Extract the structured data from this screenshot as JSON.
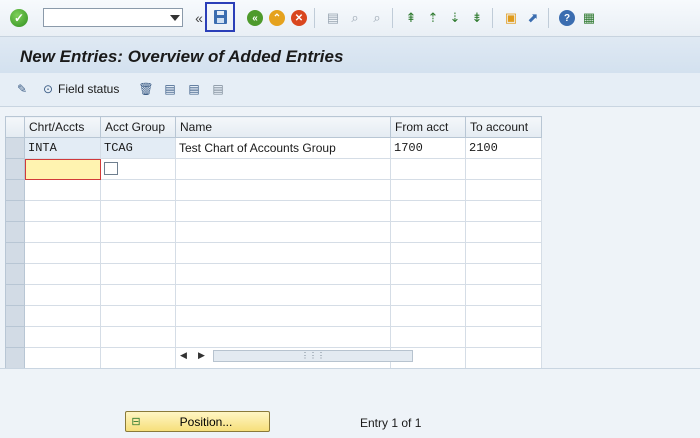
{
  "toolbar": {
    "command_value": "",
    "icons": [
      "enter-icon",
      "save-icon",
      "back-icon",
      "exit-icon",
      "cancel-icon",
      "print-icon",
      "find-icon",
      "find-next-icon",
      "first-page-icon",
      "previous-page-icon",
      "next-page-icon",
      "last-page-icon",
      "create-session-icon",
      "shortcut-icon",
      "help-icon",
      "customize-icon"
    ],
    "double_chevron": "«"
  },
  "title": "New Entries: Overview of Added Entries",
  "app_toolbar": {
    "field_status_label": "Field status"
  },
  "table": {
    "columns": [
      "Chrt/Accts",
      "Acct Group",
      "Name",
      "From acct",
      "To account"
    ],
    "rows": [
      {
        "chrt_accts": "INTA",
        "acct_group": "TCAG",
        "name": "Test Chart of Accounts Group",
        "from_acct": "1700",
        "to_account": "2100"
      }
    ]
  },
  "footer": {
    "position_label": "Position...",
    "entry_info": "Entry 1 of 1"
  },
  "colors": {
    "accent_save_border": "#2b3fb8",
    "input_highlight": "#fff3b0",
    "position_button": "#f6df7b"
  }
}
